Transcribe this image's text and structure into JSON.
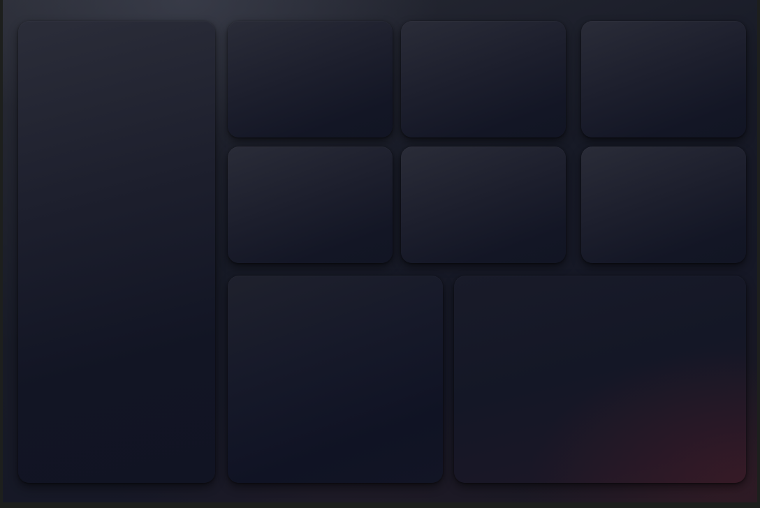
{
  "dashboard": {
    "sidebar_panel": {},
    "tiles": [
      {},
      {},
      {},
      {},
      {},
      {}
    ],
    "bottom_panels": [
      {},
      {}
    ]
  }
}
